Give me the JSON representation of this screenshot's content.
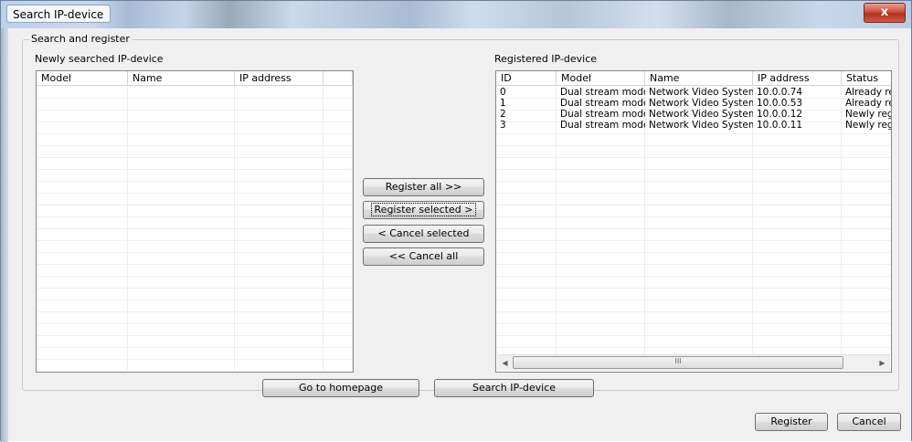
{
  "window": {
    "title": "Search IP-device",
    "close_label": "x"
  },
  "group": {
    "legend": "Search and register"
  },
  "left_list": {
    "label": "Newly searched IP-device",
    "columns": [
      "Model",
      "Name",
      "IP address"
    ],
    "rows": []
  },
  "right_list": {
    "label": "Registered IP-device",
    "columns": [
      "ID",
      "Model",
      "Name",
      "IP address",
      "Status"
    ],
    "rows": [
      [
        "0",
        "Dual stream model",
        "Network Video System",
        "10.0.0.74",
        "Already reg"
      ],
      [
        "1",
        "Dual stream model",
        "Network Video System",
        "10.0.0.53",
        "Already reg"
      ],
      [
        "2",
        "Dual stream model",
        "Network Video System",
        "10.0.0.12",
        "Newly regis"
      ],
      [
        "3",
        "Dual stream model",
        "Network Video System",
        "10.0.0.11",
        "Newly regis"
      ]
    ],
    "scrollbar_grip": "III"
  },
  "transfer_buttons": {
    "register_all": "Register all >>",
    "register_selected": "Register selected >",
    "cancel_selected": "< Cancel selected",
    "cancel_all": "<< Cancel all"
  },
  "bottom_buttons": {
    "homepage": "Go to homepage",
    "search": "Search IP-device"
  },
  "footer_buttons": {
    "register": "Register",
    "cancel": "Cancel"
  },
  "icons": {
    "scroll_left": "left-arrow-icon",
    "scroll_right": "right-arrow-icon"
  }
}
